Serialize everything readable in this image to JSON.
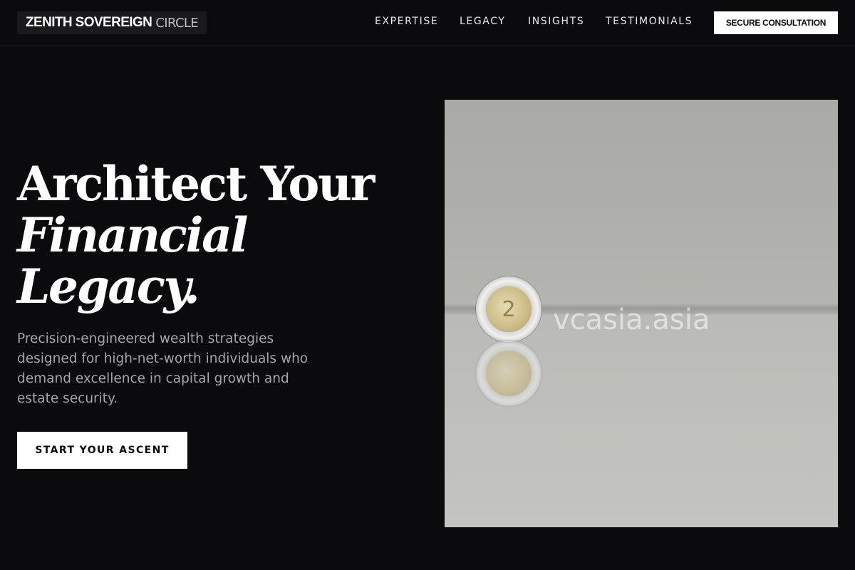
{
  "header": {
    "logo_primary": "ZENITH SOVEREIGN",
    "logo_secondary": "CIRCLE",
    "nav": [
      {
        "label": "EXPERTISE"
      },
      {
        "label": "LEGACY"
      },
      {
        "label": "INSIGHTS"
      },
      {
        "label": "TESTIMONIALS"
      }
    ],
    "cta_label": "SECURE CONSULTATION"
  },
  "hero": {
    "title_line1": "Architect Your",
    "title_line2": "Financial",
    "title_line3": "Legacy.",
    "subtitle": "Precision-engineered wealth strategies designed for high-net-worth individuals who demand excellence in capital growth and estate security.",
    "cta_label": "START YOUR ASCENT"
  },
  "hero_image": {
    "coin_glyph": "2",
    "watermark": "vcasia.asia"
  },
  "colors": {
    "background": "#0b0b0d",
    "text_primary": "#ffffff",
    "text_muted": "#a6a6a9",
    "button_bg": "#ffffff",
    "button_text": "#0b0b0d",
    "divider": "#26262a"
  }
}
